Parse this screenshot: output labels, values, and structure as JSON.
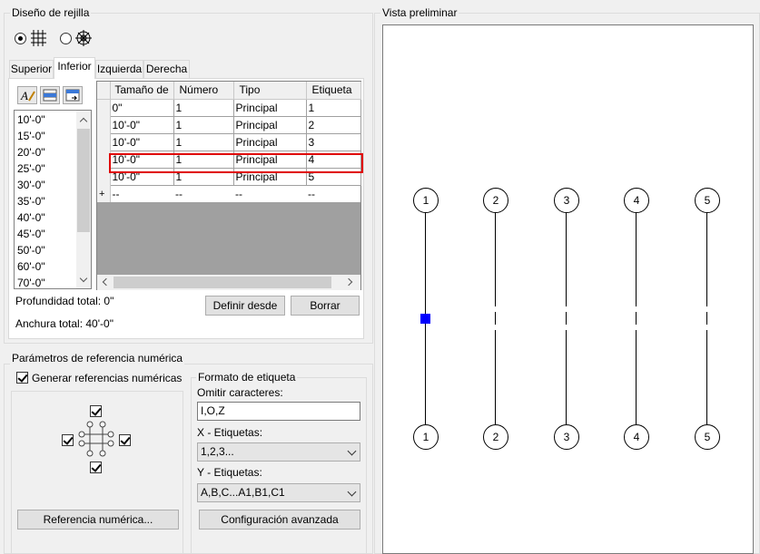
{
  "grid_design": {
    "title": "Diseño de rejilla",
    "tabs": [
      "Superior",
      "Inferior",
      "Izquierda",
      "Derecha"
    ],
    "active_tab": "Inferior",
    "list_items": [
      "10'-0\"",
      "15'-0\"",
      "20'-0\"",
      "25'-0\"",
      "30'-0\"",
      "35'-0\"",
      "40'-0\"",
      "45'-0\"",
      "50'-0\"",
      "60'-0\"",
      "70'-0\""
    ],
    "table": {
      "headers": [
        "Tamaño de",
        "Número",
        "Tipo",
        "Etiqueta"
      ],
      "rows": [
        {
          "size": "0\"",
          "number": "1",
          "type": "Principal",
          "label": "1"
        },
        {
          "size": "10'-0\"",
          "number": "1",
          "type": "Principal",
          "label": "2"
        },
        {
          "size": "10'-0\"",
          "number": "1",
          "type": "Principal",
          "label": "3"
        },
        {
          "size": "10'-0\"",
          "number": "1",
          "type": "Principal",
          "label": "4"
        },
        {
          "size": "10'-0\"",
          "number": "1",
          "type": "Principal",
          "label": "5"
        }
      ],
      "new_row": {
        "marker": "+",
        "size": "--",
        "number": "--",
        "type": "--",
        "label": "--"
      }
    },
    "total_depth": "Profundidad total: 0\"",
    "total_width": "Anchura total: 40'-0\"",
    "define_from_button": "Definir desde",
    "delete_button": "Borrar"
  },
  "numeric_reference": {
    "title": "Parámetros de referencia numérica",
    "generate_checkbox_label": "Generar referencias numéricas",
    "generate_checked": true,
    "reference_button": "Referencia numérica...",
    "label_format": {
      "title": "Formato de etiqueta",
      "omit_label": "Omitir caracteres:",
      "omit_value": "I,O,Z",
      "x_label": "X - Etiquetas:",
      "x_value": "1,2,3...",
      "y_label": "Y - Etiquetas:",
      "y_value": "A,B,C...A1,B1,C1",
      "advanced_button": "Configuración avanzada"
    }
  },
  "preview": {
    "title": "Vista preliminar",
    "top_labels": [
      "1",
      "2",
      "3",
      "4",
      "5"
    ],
    "bottom_labels": [
      "1",
      "2",
      "3",
      "4",
      "5"
    ]
  },
  "colors": {
    "highlight": "#e00000",
    "selection": "#0000ff"
  }
}
